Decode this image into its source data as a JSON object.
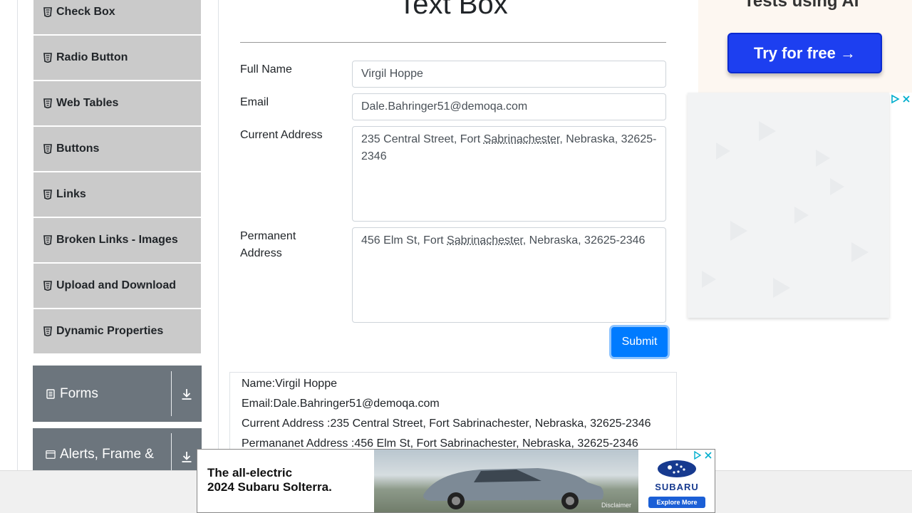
{
  "sidebar": {
    "elements_items": [
      {
        "label": "Check Box"
      },
      {
        "label": "Radio Button"
      },
      {
        "label": "Web Tables"
      },
      {
        "label": "Buttons"
      },
      {
        "label": "Links"
      },
      {
        "label": "Broken Links - Images"
      },
      {
        "label": "Upload and Download"
      },
      {
        "label": "Dynamic Properties"
      }
    ],
    "groups": [
      {
        "label": "Forms"
      },
      {
        "label": "Alerts, Frame &"
      }
    ]
  },
  "main": {
    "title": "Text Box",
    "fields": {
      "full_name_label": "Full Name",
      "full_name_value": "Virgil Hoppe",
      "email_label": "Email",
      "email_value": "Dale.Bahringer51@demoqa.com",
      "current_address_label": "Current Address",
      "current_address_pre": "235 Central Street, Fort ",
      "current_address_city": "Sabrinachester",
      "current_address_post": ", Nebraska, 32625-2346",
      "permanent_address_label_1": "Permanent",
      "permanent_address_label_2": "Address",
      "permanent_address_pre": "456 Elm St, Fort ",
      "permanent_address_city": "Sabrinachester",
      "permanent_address_post": ", Nebraska, 32625-2346"
    },
    "submit_label": "Submit",
    "output": {
      "name": "Name:Virgil Hoppe",
      "email": "Email:Dale.Bahringer51@demoqa.com",
      "current_address": "Current Address :235 Central Street, Fort Sabrinachester, Nebraska, 32625-2346",
      "permanent_address": "Permananet Address :456 Elm St, Fort Sabrinachester, Nebraska, 32625-2346"
    }
  },
  "ads": {
    "top_text": "Tests using AI",
    "top_button": "Try for free →",
    "banner_line1": "The all-electric",
    "banner_line2": "2024 Subaru Solterra.",
    "banner_brand": "SUBARU",
    "banner_cta": "Explore More",
    "banner_disclaimer": "Disclaimer"
  },
  "colors": {
    "submit": "#007bff",
    "menu_item_bg": "#cacaca",
    "group_bg": "#6c757d",
    "ad_button": "#1d3ff0",
    "ad_choices": "#00aecd"
  }
}
